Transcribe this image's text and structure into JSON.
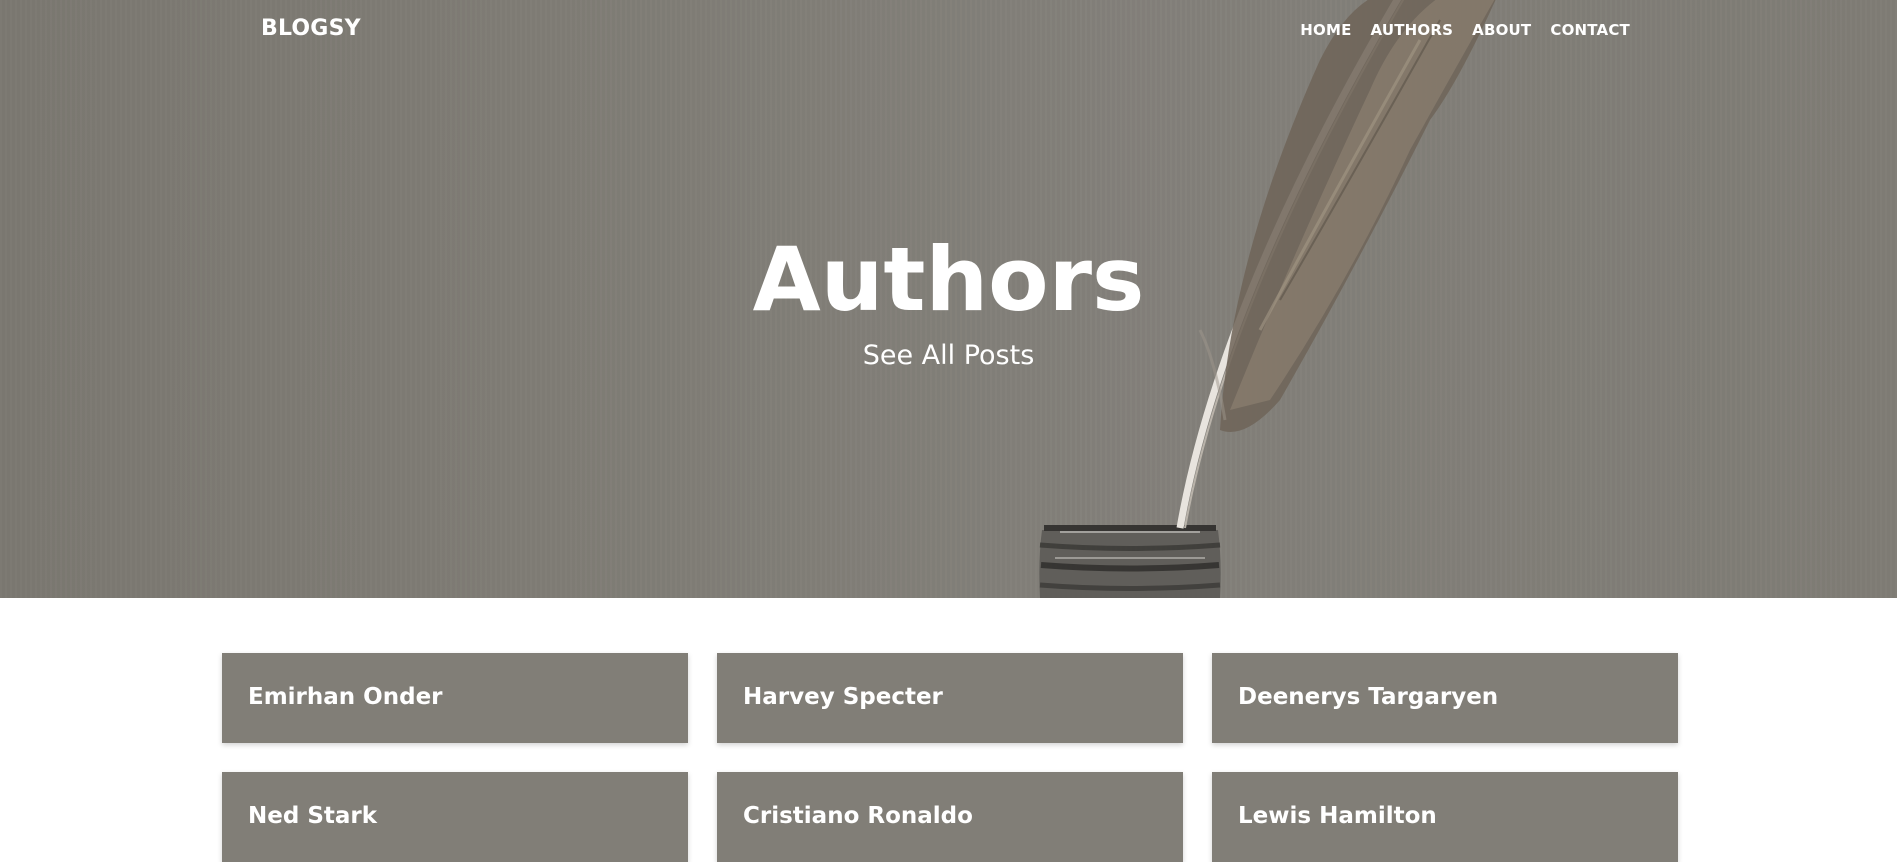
{
  "nav": {
    "brand": "BLOGSY",
    "links": [
      {
        "label": "HOME"
      },
      {
        "label": "AUTHORS"
      },
      {
        "label": "ABOUT"
      },
      {
        "label": "CONTACT"
      }
    ]
  },
  "hero": {
    "title": "Authors",
    "subtitle": "See All Posts"
  },
  "authors": [
    {
      "name": "Emirhan Onder"
    },
    {
      "name": "Harvey Specter"
    },
    {
      "name": "Deenerys Targaryen"
    },
    {
      "name": "Ned Stark"
    },
    {
      "name": "Cristiano Ronaldo"
    },
    {
      "name": "Lewis Hamilton"
    }
  ],
  "colors": {
    "hero_background": "#807d76",
    "card_background": "#817e77",
    "text": "#ffffff"
  }
}
